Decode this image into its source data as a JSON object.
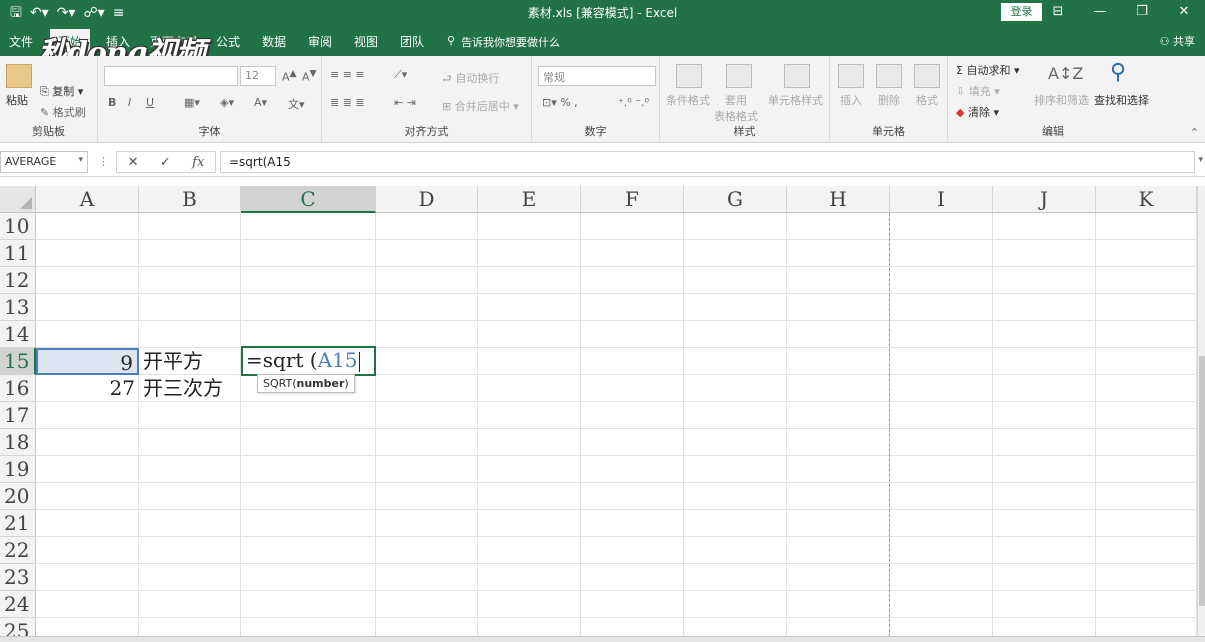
{
  "titlebar": {
    "title": "素材.xls  [兼容模式]  -  Excel",
    "login": "登录",
    "save_icon": "save-icon",
    "undo_icon": "undo-icon",
    "redo_icon": "redo-icon"
  },
  "logo": {
    "text": "秒dong视频"
  },
  "tabs": [
    {
      "label": "文件"
    },
    {
      "label": "开始"
    },
    {
      "label": "插入"
    },
    {
      "label": "页面布局"
    },
    {
      "label": "公式"
    },
    {
      "label": "数据"
    },
    {
      "label": "审阅"
    },
    {
      "label": "视图"
    },
    {
      "label": "团队"
    }
  ],
  "tellme": "告诉我你想要做什么",
  "share": "共享",
  "ribbon": {
    "clipboard": {
      "label": "剪贴板",
      "paste": "粘贴",
      "cut": "剪切",
      "copy": "复制",
      "format_painter": "格式刷"
    },
    "font": {
      "label": "字体",
      "size": "12",
      "bold": "B",
      "italic": "I",
      "underline": "U"
    },
    "alignment": {
      "label": "对齐方式",
      "wrap": "自动换行",
      "merge": "合并后居中"
    },
    "number": {
      "label": "数字",
      "format": "常规"
    },
    "styles": {
      "label": "样式",
      "conditional": "条件格式",
      "table": "套用\n表格格式",
      "cell_styles": "单元格样式"
    },
    "cells": {
      "label": "单元格",
      "insert": "插入",
      "delete": "删除",
      "format": "格式"
    },
    "editing": {
      "label": "编辑",
      "autosum": "自动求和",
      "fill": "填充",
      "clear": "清除",
      "sort": "排序和筛选",
      "find": "查找和选择"
    }
  },
  "formula_bar": {
    "name_box": "AVERAGE",
    "formula": "=sqrt(A15"
  },
  "columns": [
    "A",
    "B",
    "C",
    "D",
    "E",
    "F",
    "G",
    "H",
    "I",
    "J",
    "K"
  ],
  "rows": [
    "10",
    "11",
    "12",
    "13",
    "14",
    "15",
    "16",
    "17",
    "18",
    "19",
    "20",
    "21",
    "22",
    "23",
    "24",
    "25"
  ],
  "cells": {
    "a15": "9",
    "b15": "开平方",
    "a16": "27",
    "b16": "开三次方"
  },
  "edit_cell": {
    "func": "=sqrt (",
    "ref": "A15"
  },
  "tooltip": {
    "func": "SQRT(",
    "arg": "number",
    "close": ")"
  }
}
